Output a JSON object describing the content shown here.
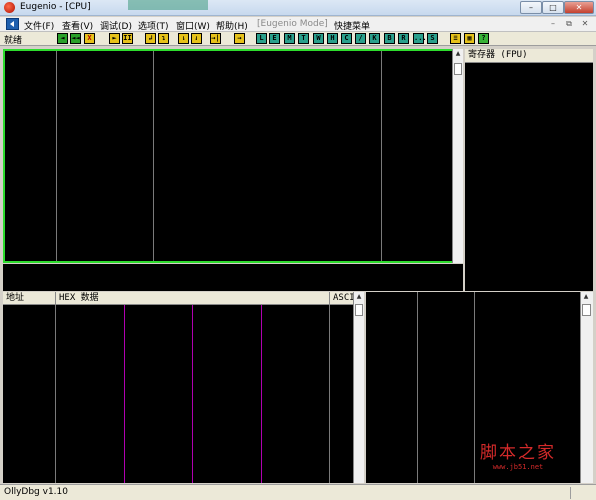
{
  "window": {
    "title": "Eugenio - [CPU]",
    "controls": {
      "minimize": "–",
      "maximize": "□",
      "close": "✕"
    }
  },
  "menubar": {
    "items": [
      {
        "label": "文件(F)"
      },
      {
        "label": "查看(V)"
      },
      {
        "label": "调试(D)"
      },
      {
        "label": "选项(T)"
      },
      {
        "label": "窗口(W)"
      },
      {
        "label": "帮助(H)"
      },
      {
        "label": "[Eugenio Mode]",
        "disabled": true
      },
      {
        "label": "快捷菜单"
      }
    ],
    "mdi_controls": {
      "minimize": "–",
      "restore": "⧉",
      "close": "✕"
    }
  },
  "toolbar": {
    "status": "就绪",
    "buttons": [
      {
        "glyph": "◄",
        "style": "green",
        "icon": "open-icon"
      },
      {
        "glyph": "◄◄",
        "style": "green",
        "icon": "restart-icon"
      },
      {
        "glyph": "X",
        "style": "red",
        "icon": "close-icon"
      },
      {
        "glyph": "►",
        "style": "yellow",
        "icon": "run-icon"
      },
      {
        "glyph": "II",
        "style": "yellow",
        "icon": "pause-icon"
      },
      {
        "glyph": "↲",
        "style": "yellow",
        "icon": "step-into-icon"
      },
      {
        "glyph": "↴",
        "style": "yellow",
        "icon": "step-over-icon"
      },
      {
        "glyph": "⇂",
        "style": "yellow",
        "icon": "trace-into-icon"
      },
      {
        "glyph": "⇃",
        "style": "yellow",
        "icon": "trace-over-icon"
      },
      {
        "glyph": "→|",
        "style": "yellow",
        "icon": "execute-till-return-icon"
      },
      {
        "glyph": "→",
        "style": "yellow",
        "icon": "goto-icon"
      },
      {
        "glyph": "L",
        "style": "teal",
        "icon": "log-icon"
      },
      {
        "glyph": "E",
        "style": "teal",
        "icon": "executables-icon"
      },
      {
        "glyph": "M",
        "style": "teal",
        "icon": "memory-icon"
      },
      {
        "glyph": "T",
        "style": "teal",
        "icon": "threads-icon"
      },
      {
        "glyph": "W",
        "style": "teal",
        "icon": "windows-icon"
      },
      {
        "glyph": "H",
        "style": "teal",
        "icon": "handles-icon"
      },
      {
        "glyph": "C",
        "style": "teal",
        "icon": "cpu-icon"
      },
      {
        "glyph": "/",
        "style": "teal",
        "icon": "patches-icon"
      },
      {
        "glyph": "K",
        "style": "teal",
        "icon": "call-stack-icon"
      },
      {
        "glyph": "B",
        "style": "teal",
        "icon": "breakpoints-icon"
      },
      {
        "glyph": "R",
        "style": "teal",
        "icon": "references-icon"
      },
      {
        "glyph": "...",
        "style": "teal",
        "icon": "run-trace-icon"
      },
      {
        "glyph": "S",
        "style": "teal",
        "icon": "source-icon"
      },
      {
        "glyph": "≡",
        "style": "yellow",
        "icon": "options-icon"
      },
      {
        "glyph": "▦",
        "style": "yellow",
        "icon": "appearance-icon"
      },
      {
        "glyph": "?",
        "style": "help",
        "icon": "help-icon"
      }
    ]
  },
  "registers_pane": {
    "header": "寄存器 (FPU)"
  },
  "dump_pane": {
    "columns": [
      {
        "label": "地址"
      },
      {
        "label": "HEX 数据"
      },
      {
        "label": "ASCI"
      }
    ]
  },
  "watermark": {
    "text": "脚本之家",
    "url": "www.jb51.net"
  },
  "statusbar": {
    "text": "OllyDbg v1.10"
  }
}
